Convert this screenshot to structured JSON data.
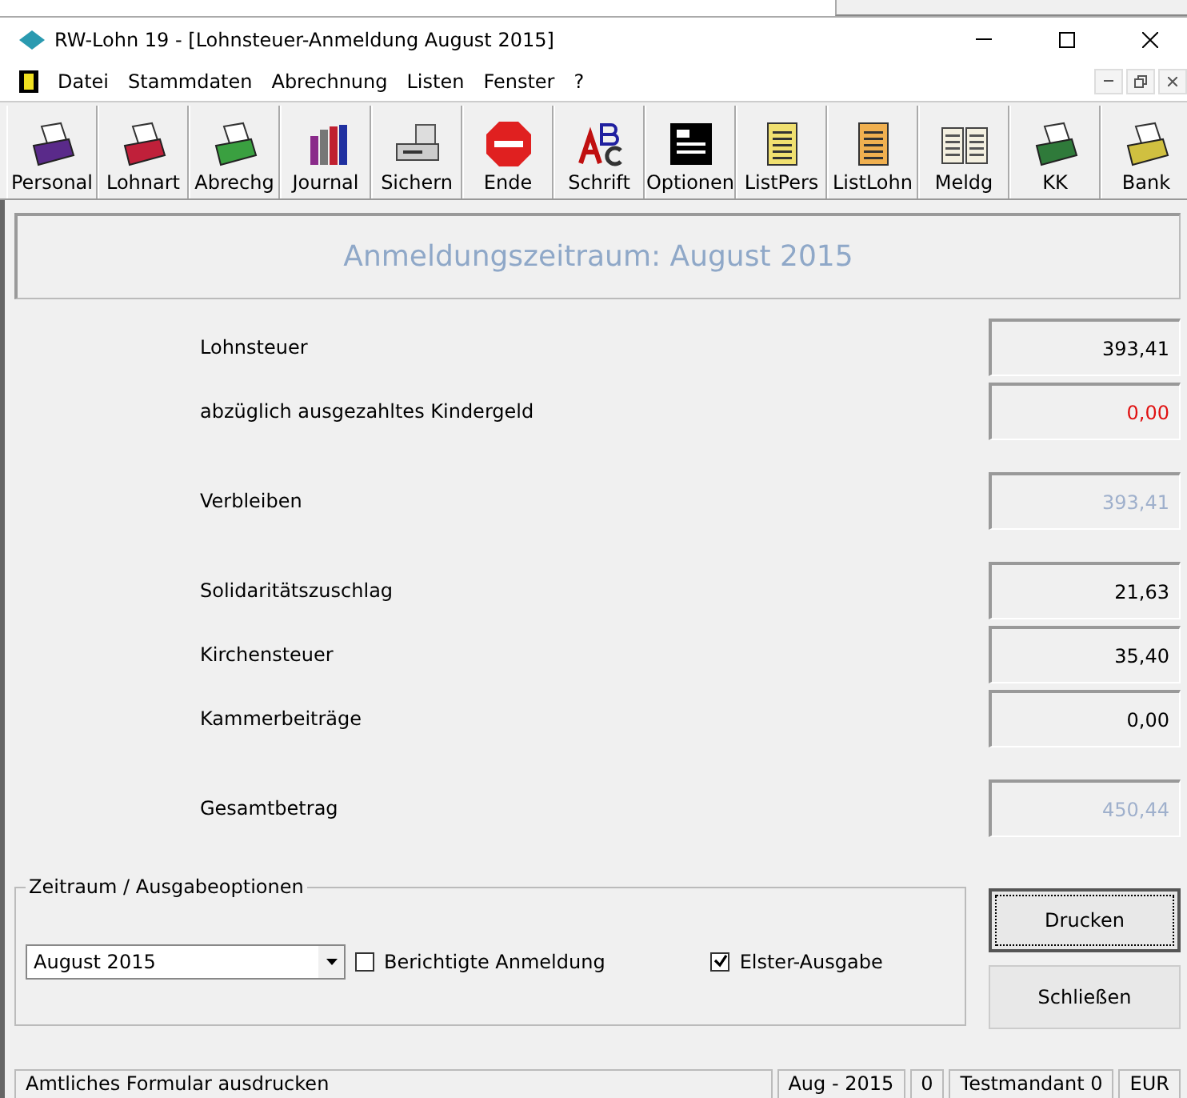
{
  "window": {
    "title": "RW-Lohn 19  - [Lohnsteuer-Anmeldung August 2015]"
  },
  "menu": [
    "Datei",
    "Stammdaten",
    "Abrechnung",
    "Listen",
    "Fenster",
    "?"
  ],
  "toolbar": [
    {
      "label": "Personal",
      "kind": "cardfile",
      "color": "#5a2a8a"
    },
    {
      "label": "Lohnart",
      "kind": "cardfile",
      "color": "#c0203a"
    },
    {
      "label": "Abrechg",
      "kind": "cardfile",
      "color": "#3aa040"
    },
    {
      "label": "Journal",
      "kind": "books"
    },
    {
      "label": "Sichern",
      "kind": "drive"
    },
    {
      "label": "Ende",
      "kind": "stop"
    },
    {
      "label": "Schrift",
      "kind": "letters"
    },
    {
      "label": "Optionen",
      "kind": "form"
    },
    {
      "label": "ListPers",
      "kind": "list",
      "color": "#f0e070"
    },
    {
      "label": "ListLohn",
      "kind": "list",
      "color": "#f0b050"
    },
    {
      "label": "Meldg",
      "kind": "book"
    },
    {
      "label": "KK",
      "kind": "cardfile",
      "color": "#2f7a3a"
    },
    {
      "label": "Bank",
      "kind": "cardfile",
      "color": "#d0c040"
    }
  ],
  "heading": "Anmeldungszeitraum: August 2015",
  "groups": [
    [
      {
        "label": "Lohnsteuer",
        "value": "393,41",
        "kind": "amount"
      },
      {
        "label": "abzüglich ausgezahltes Kindergeld",
        "value": "0,00",
        "kind": "deduction"
      }
    ],
    [
      {
        "label": "Verbleiben",
        "value": "393,41",
        "kind": "subtotal"
      }
    ],
    [
      {
        "label": "Solidaritätszuschlag",
        "value": "21,63",
        "kind": "amount"
      },
      {
        "label": "Kirchensteuer",
        "value": "35,40",
        "kind": "amount"
      },
      {
        "label": "Kammerbeiträge",
        "value": "0,00",
        "kind": "amount"
      }
    ],
    [
      {
        "label": "Gesamtbetrag",
        "value": "450,44",
        "kind": "subtotal"
      }
    ]
  ],
  "options": {
    "legend": "Zeitraum / Ausgabeoptionen",
    "period": "August 2015",
    "checkboxes": [
      {
        "label": "Berichtigte Anmeldung",
        "checked": false
      },
      {
        "label": "Elster-Ausgabe",
        "checked": true
      }
    ]
  },
  "buttons": [
    {
      "label": "Drucken",
      "default": true
    },
    {
      "label": "Schließen",
      "default": false
    }
  ],
  "status_bar": [
    "Amtliches Formular ausdrucken",
    "Aug - 2015",
    "0",
    "Testmandant 0",
    "EUR"
  ]
}
